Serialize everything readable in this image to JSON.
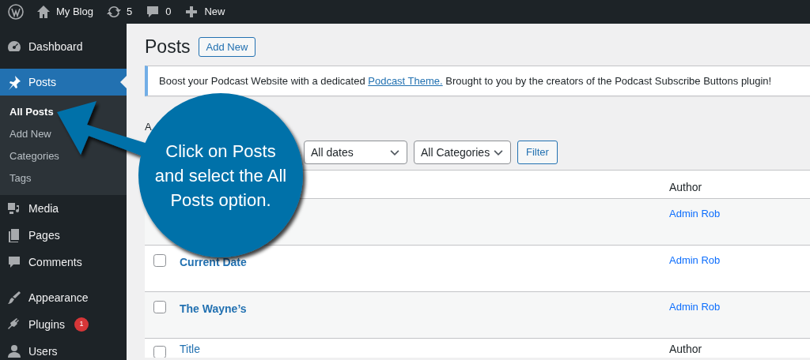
{
  "admin_bar": {
    "site": "My Blog",
    "updates": "5",
    "comments": "0",
    "new": "New"
  },
  "sidebar": {
    "groups": [
      [
        {
          "label": "Dashboard",
          "selected": false
        }
      ],
      [
        {
          "label": "Posts",
          "selected": true,
          "children": [
            {
              "label": "All Posts",
              "selected": true
            },
            {
              "label": "Add New",
              "selected": false
            },
            {
              "label": "Categories",
              "selected": false
            },
            {
              "label": "Tags",
              "selected": false
            }
          ]
        },
        {
          "label": "Media",
          "selected": false
        },
        {
          "label": "Pages",
          "selected": false
        },
        {
          "label": "Comments",
          "selected": false
        }
      ],
      [
        {
          "label": "Appearance",
          "selected": false
        },
        {
          "label": "Plugins",
          "selected": false,
          "badge": "1"
        },
        {
          "label": "Users",
          "selected": false
        }
      ]
    ]
  },
  "page": {
    "title": "Posts",
    "add_new": "Add New"
  },
  "notice": {
    "before": "Boost your Podcast Website with a dedicated ",
    "link": "Podcast Theme.",
    "after": " Brought to you by the creators of the Podcast Subscribe Buttons plugin!"
  },
  "views": "A",
  "filters": {
    "selects": [
      "All dates",
      "All Categories"
    ],
    "button": "Filter"
  },
  "table": {
    "header": {
      "column_2": "Author"
    },
    "rows": [
      {
        "author": "Admin Rob"
      },
      {
        "title": "Current Date",
        "author": "Admin Rob",
        "checked": false
      },
      {
        "title": "The Wayne’s",
        "author": "Admin Rob",
        "checked": false
      }
    ],
    "footer": {
      "checked": false,
      "title": "Title",
      "author": "Author"
    }
  },
  "callout": {
    "text": "Click on Posts and select the All Posts option."
  }
}
